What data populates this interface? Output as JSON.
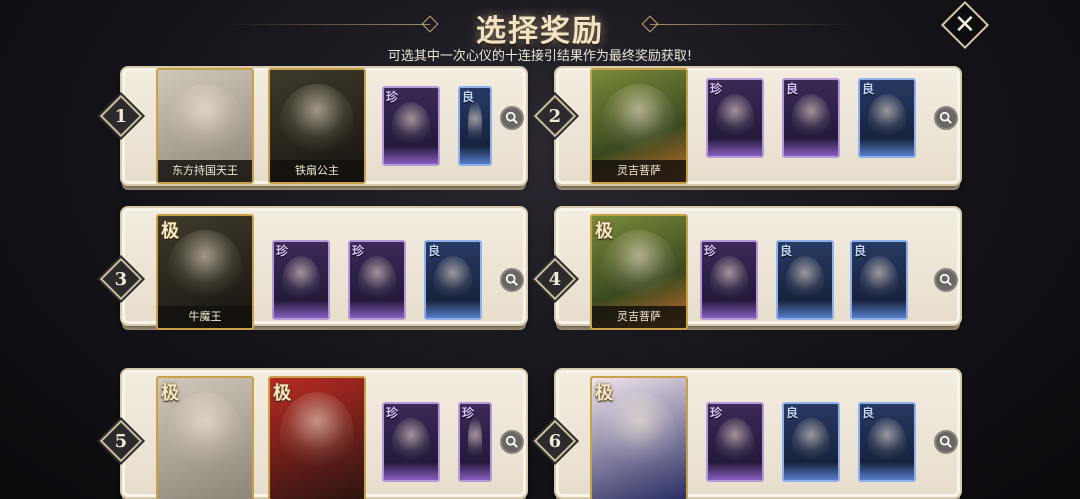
{
  "header": {
    "title": "选择奖励",
    "subtitle": "可选其中一次心仪的十连接引结果作为最终奖励获取!",
    "close_icon": "close-x-icon"
  },
  "panels": [
    {
      "number": "1",
      "cards": [
        {
          "rank": "",
          "name": "东方持国天王",
          "style": "gray"
        },
        {
          "rank": "",
          "name": "铁扇公主",
          "style": "dark"
        },
        {
          "tag": "珍",
          "tier": "purple"
        },
        {
          "tag": "良",
          "tier": "blue"
        }
      ]
    },
    {
      "number": "2",
      "cards": [
        {
          "rank": "",
          "name": "灵吉菩萨",
          "style": "green"
        },
        {
          "tag": "珍",
          "tier": "purple"
        },
        {
          "tag": "良",
          "tier": "purple"
        },
        {
          "tag": "良",
          "tier": "blue"
        }
      ]
    },
    {
      "number": "3",
      "cards": [
        {
          "rank": "极",
          "name": "牛魔王",
          "style": "dark"
        },
        {
          "tag": "珍",
          "tier": "purple"
        },
        {
          "tag": "珍",
          "tier": "purple"
        },
        {
          "tag": "良",
          "tier": "blue"
        }
      ]
    },
    {
      "number": "4",
      "cards": [
        {
          "rank": "极",
          "name": "灵吉菩萨",
          "style": "green"
        },
        {
          "tag": "珍",
          "tier": "purple"
        },
        {
          "tag": "良",
          "tier": "blue"
        },
        {
          "tag": "良",
          "tier": "blue"
        }
      ]
    },
    {
      "number": "5",
      "cards": [
        {
          "rank": "极",
          "name": "",
          "style": "gray"
        },
        {
          "rank": "极",
          "name": "",
          "style": "red"
        },
        {
          "tag": "珍",
          "tier": "purple"
        },
        {
          "tag": "珍",
          "tier": "purple"
        }
      ]
    },
    {
      "number": "6",
      "cards": [
        {
          "rank": "极",
          "name": "",
          "style": "blue"
        },
        {
          "tag": "珍",
          "tier": "purple"
        },
        {
          "tag": "良",
          "tier": "blue"
        },
        {
          "tag": "良",
          "tier": "blue"
        }
      ]
    }
  ],
  "colors": {
    "panel_bg": "#f3ede1",
    "gold_frame": "#c9a14a",
    "purple_tier": "#b69ad8",
    "blue_tier": "#8fb0e8"
  }
}
